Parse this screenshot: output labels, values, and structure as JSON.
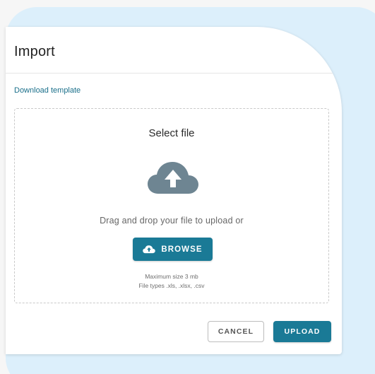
{
  "dialog": {
    "title": "Import",
    "download_link": "Download template"
  },
  "dropzone": {
    "title": "Select file",
    "icon": "cloud-upload-icon",
    "hint": "Drag and drop your file to upload or",
    "browse_label": "BROWSE",
    "max_size": "Maximum size 3 mb",
    "file_types": "File types .xls, .xlsx, .csv"
  },
  "actions": {
    "cancel_label": "CANCEL",
    "upload_label": "UPLOAD"
  },
  "colors": {
    "accent": "#1a7a96",
    "link": "#1a6f8a",
    "cloud_icon": "#6e8592",
    "backdrop": "#dceffb"
  }
}
